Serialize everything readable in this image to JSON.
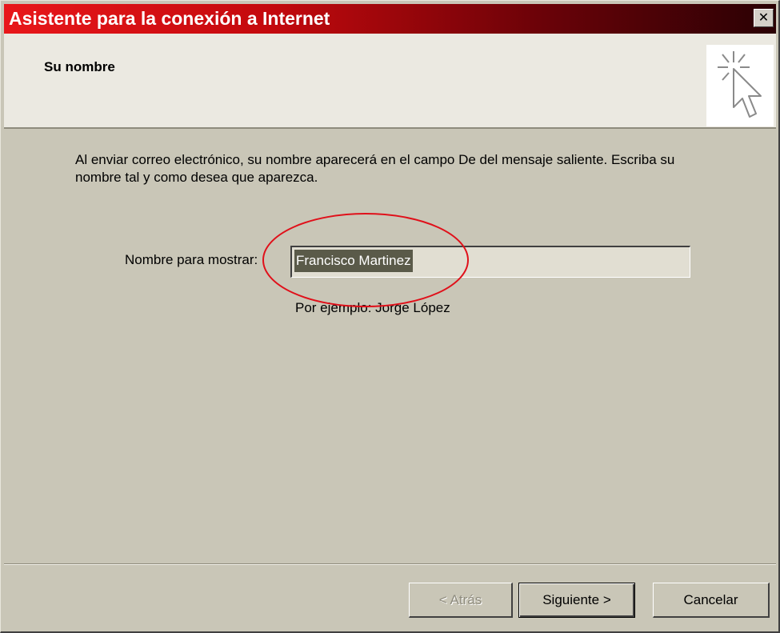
{
  "window": {
    "title": "Asistente para la conexión a Internet",
    "close_glyph": "✕"
  },
  "header": {
    "title": "Su nombre",
    "icon": "wizard-cursor-icon"
  },
  "body": {
    "intro": "Al enviar correo electrónico, su nombre aparecerá en el campo De del mensaje saliente. Escriba su nombre tal y como desea que aparezca.",
    "name_label": "Nombre para mostrar:",
    "name_value": "Francisco Martinez",
    "example": "Por ejemplo: Jorge López"
  },
  "buttons": {
    "back": "< Atrás",
    "next": "Siguiente >",
    "cancel": "Cancelar"
  },
  "colors": {
    "titlebar_start": "#e8171a",
    "titlebar_end": "#2a0104",
    "dialog_face": "#c9c6b7",
    "annotation_ring": "#e0101a"
  }
}
